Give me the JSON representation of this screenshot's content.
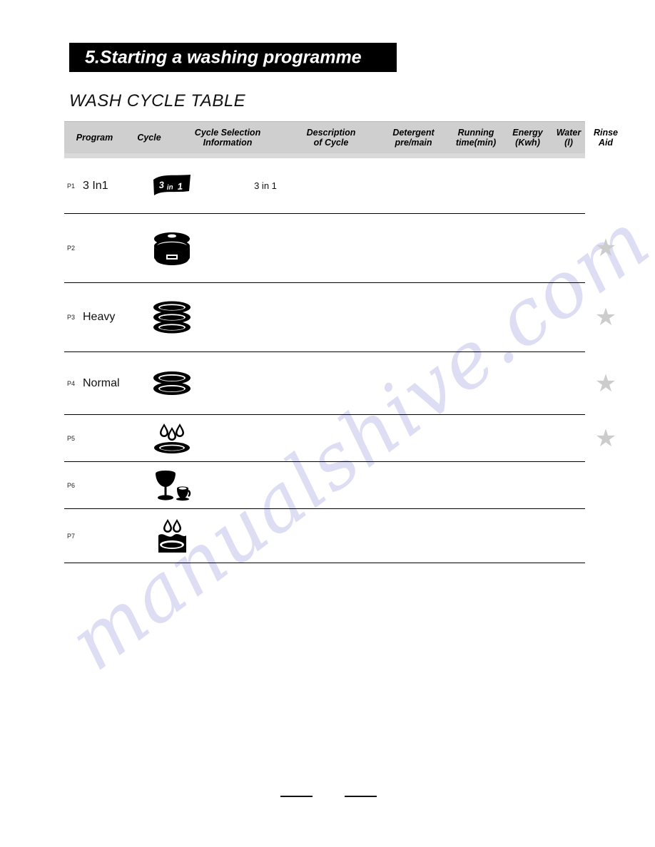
{
  "page": {
    "section_title": "5.Starting a washing programme",
    "table_caption": "WASH CYCLE TABLE",
    "watermark": "manualshive.com"
  },
  "table": {
    "headers": [
      {
        "line1": "Program",
        "line2": ""
      },
      {
        "line1": "Cycle",
        "line2": ""
      },
      {
        "line1": "Cycle Selection",
        "line2": "Information"
      },
      {
        "line1": "Description",
        "line2": "of Cycle"
      },
      {
        "line1": "Detergent",
        "line2": "pre/main"
      },
      {
        "line1": "Running",
        "line2": "time(min)"
      },
      {
        "line1": "Energy",
        "line2": "(Kwh)"
      },
      {
        "line1": "Water",
        "line2": "(l)"
      },
      {
        "line1": "Rinse",
        "line2": "Aid"
      }
    ],
    "rows": [
      {
        "program": "P1",
        "cycle": "3 In1",
        "icon": "flag-3in1-icon",
        "icon_label": "3 in 1",
        "description": "",
        "detergent": "",
        "running_time": "",
        "energy": "",
        "water": "",
        "rinse_aid": ""
      },
      {
        "program": "P2",
        "cycle": "",
        "icon": "pot-with-lid-icon",
        "icon_label": "",
        "description": "",
        "detergent": "",
        "running_time": "",
        "energy": "",
        "water": "",
        "rinse_aid": "★"
      },
      {
        "program": "P3",
        "cycle": "Heavy",
        "icon": "three-stacked-plates-icon",
        "icon_label": "",
        "description": "",
        "detergent": "",
        "running_time": "",
        "energy": "",
        "water": "",
        "rinse_aid": "★"
      },
      {
        "program": "P4",
        "cycle": "Normal",
        "icon": "two-stacked-plates-icon",
        "icon_label": "",
        "description": "",
        "detergent": "",
        "running_time": "",
        "energy": "",
        "water": "",
        "rinse_aid": "★"
      },
      {
        "program": "P5",
        "cycle": "",
        "icon": "plate-three-drops-icon",
        "icon_label": "",
        "description": "",
        "detergent": "",
        "running_time": "",
        "energy": "",
        "water": "",
        "rinse_aid": "★"
      },
      {
        "program": "P6",
        "cycle": "",
        "icon": "wine-glass-and-cup-icon",
        "icon_label": "",
        "description": "",
        "detergent": "",
        "running_time": "",
        "energy": "",
        "water": "",
        "rinse_aid": ""
      },
      {
        "program": "P7",
        "cycle": "",
        "icon": "plate-in-water-two-drops-icon",
        "icon_label": "",
        "description": "",
        "detergent": "",
        "running_time": "",
        "energy": "",
        "water": "",
        "rinse_aid": ""
      }
    ]
  },
  "colors": {
    "header_bg": "#cfcfcf",
    "title_bar_bg": "#000000",
    "title_bar_fg": "#ffffff",
    "star": "#cccccc",
    "rule": "#000000",
    "watermark": "#c9c9ee"
  }
}
